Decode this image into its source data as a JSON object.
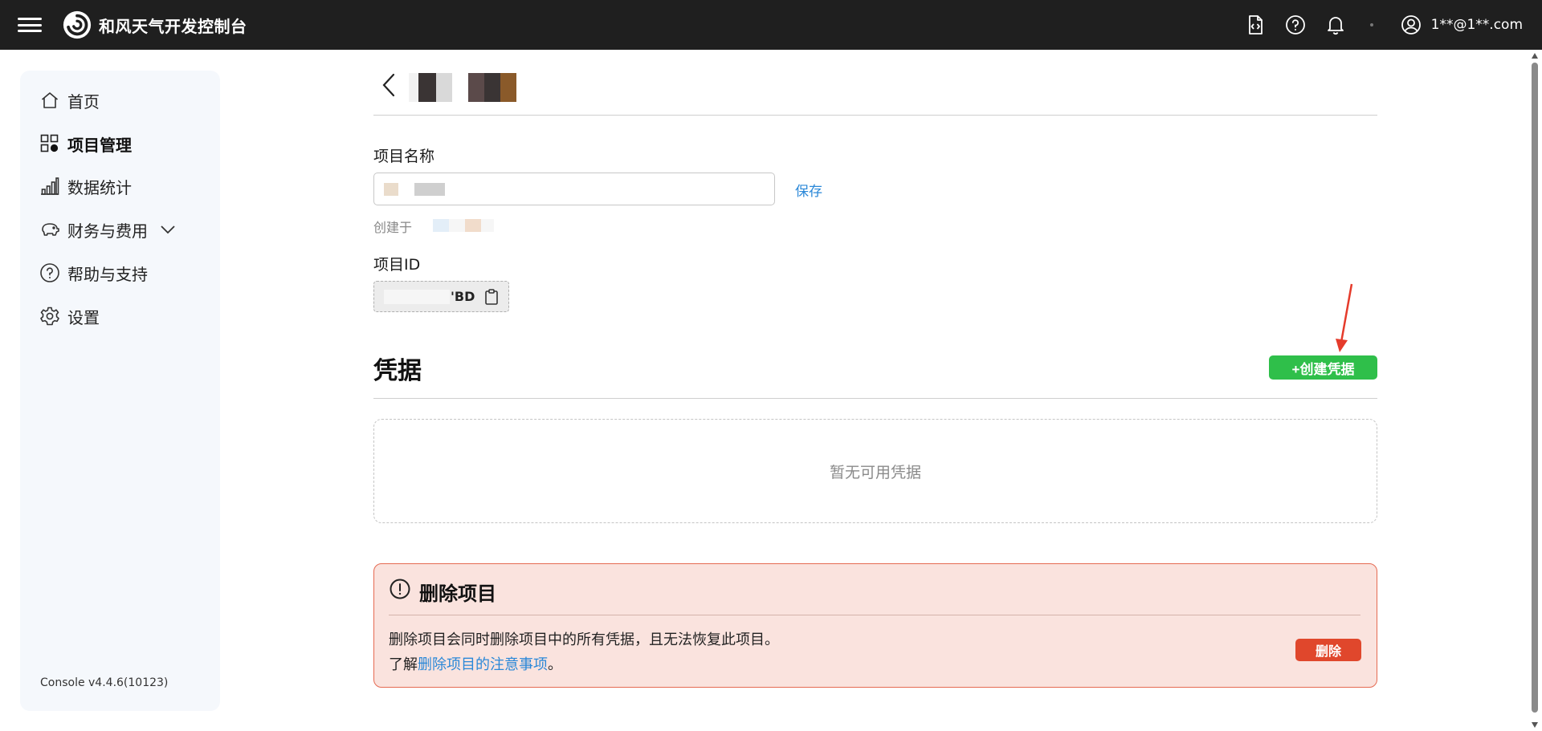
{
  "header": {
    "brand": "和风天气开发控制台",
    "user_email": "1**@1**.com",
    "icons": [
      "menu-icon",
      "logo-icon",
      "api-doc-icon",
      "help-icon",
      "bell-icon",
      "user-icon"
    ]
  },
  "sidebar": {
    "items": [
      {
        "label": "首页",
        "icon": "home-icon"
      },
      {
        "label": "项目管理",
        "icon": "grid-icon",
        "active": true
      },
      {
        "label": "数据统计",
        "icon": "bar-chart-icon"
      },
      {
        "label": "财务与费用",
        "icon": "piggy-bank-icon",
        "expandable": true
      },
      {
        "label": "帮助与支持",
        "icon": "help-icon"
      },
      {
        "label": "设置",
        "icon": "gear-icon"
      }
    ],
    "version": "Console v4.4.6(10123)"
  },
  "project": {
    "name_label": "项目名称",
    "save_label": "保存",
    "created_label": "创建于",
    "id_label": "项目ID",
    "id_suffix": "'BD"
  },
  "credentials": {
    "title": "凭据",
    "create_label": "+创建凭据",
    "empty_text": "暂无可用凭据"
  },
  "danger": {
    "title": "删除项目",
    "text": "删除项目会同时删除项目中的所有凭据，且无法恢复此项目。",
    "learn_prefix": "了解",
    "learn_link": "删除项目的注意事项",
    "learn_suffix": "。",
    "delete_label": "删除"
  },
  "colors": {
    "topbar_bg": "#1f1f1f",
    "sidebar_bg": "#f5f8fc",
    "link": "#2b88d8",
    "create_button": "#2fbf4a",
    "danger_bg": "#fae3de",
    "danger_border": "#e56a52",
    "delete_button": "#e0472c",
    "annotation_arrow": "#e53b2b"
  }
}
